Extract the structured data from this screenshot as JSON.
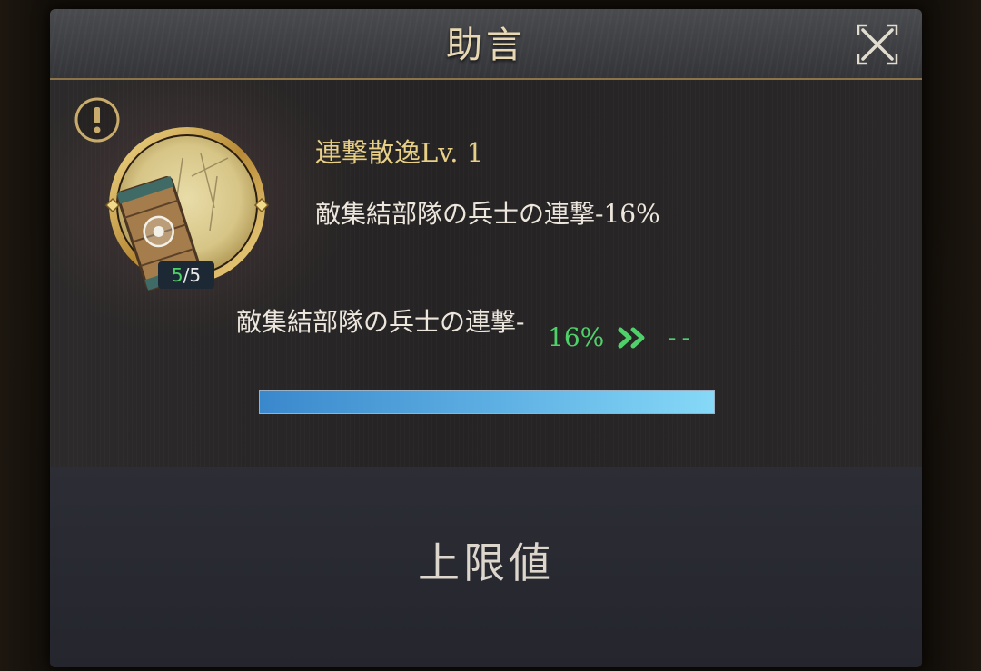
{
  "dialog": {
    "title": "助言",
    "close_icon": "close-icon"
  },
  "skill": {
    "icon": "skill-shield-icon",
    "warning_icon": "exclamation-icon",
    "level_current": "5",
    "level_separator": "/",
    "level_max": "5",
    "name": "連撃散逸Lv. 1",
    "description": "敵集結部隊の兵士の連撃-16%"
  },
  "stat": {
    "label": "敵集結部隊の兵士の連撃-",
    "current_value": "16%",
    "arrow_icon": "double-chevron-right-icon",
    "next_value": "--",
    "progress_fraction": 1.0
  },
  "footer": {
    "max_label": "上限値"
  },
  "colors": {
    "accent_gold": "#e8cf86",
    "value_green": "#4fd16a",
    "progress_blue": "#5fb2e4"
  }
}
